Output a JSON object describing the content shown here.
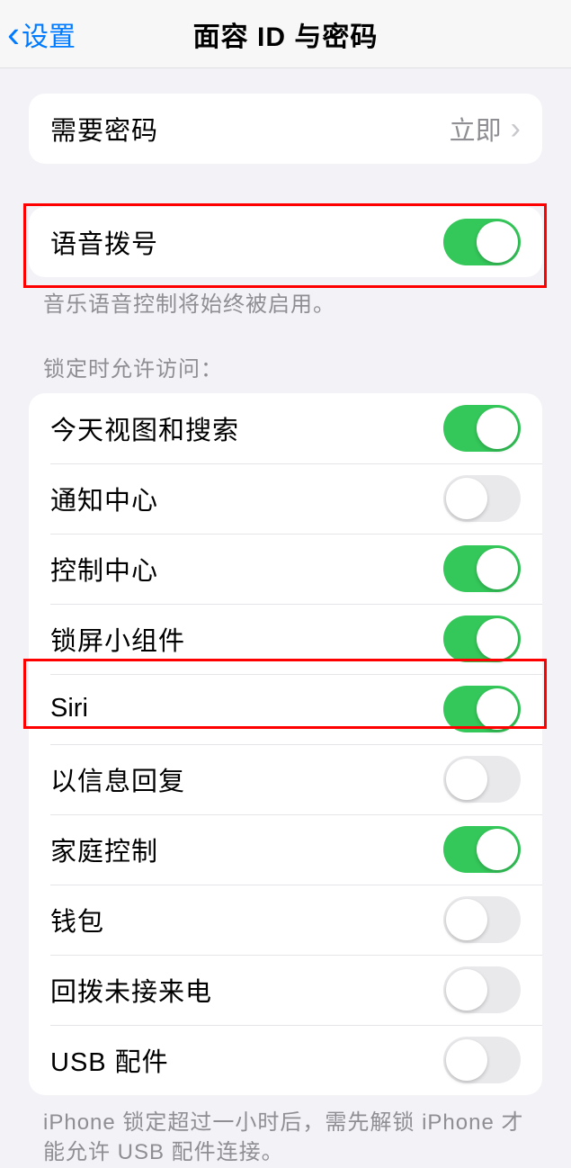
{
  "nav": {
    "back_label": "设置",
    "title": "面容 ID 与密码"
  },
  "group_require": {
    "label": "需要密码",
    "value": "立即"
  },
  "group_voice": {
    "label": "语音拨号",
    "footer": "音乐语音控制将始终被启用。",
    "on": true
  },
  "lock_header": "锁定时允许访问：",
  "lock_items": [
    {
      "label": "今天视图和搜索",
      "on": true
    },
    {
      "label": "通知中心",
      "on": false
    },
    {
      "label": "控制中心",
      "on": true
    },
    {
      "label": "锁屏小组件",
      "on": true
    },
    {
      "label": "Siri",
      "on": true
    },
    {
      "label": "以信息回复",
      "on": false
    },
    {
      "label": "家庭控制",
      "on": true
    },
    {
      "label": "钱包",
      "on": false
    },
    {
      "label": "回拨未接来电",
      "on": false
    },
    {
      "label": "USB 配件",
      "on": false
    }
  ],
  "lock_footer": "iPhone 锁定超过一小时后，需先解锁 iPhone 才能允许 USB 配件连接。"
}
